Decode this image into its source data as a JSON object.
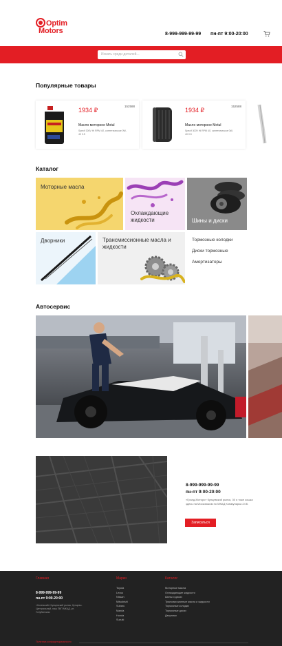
{
  "header": {
    "logo_line1": "Optim",
    "logo_line2": "Motors",
    "phone": "8-999-999-99-99",
    "hours": "пн-пт 9:00-20:00"
  },
  "search": {
    "placeholder": "Искать среди деталей..."
  },
  "popular": {
    "title": "Популярные товары",
    "products": [
      {
        "sku": "152588",
        "price": "1934 ₽",
        "name": "Масло моторное Motul",
        "desc": "Specif 300V Hi RPM 4Л, синтетическое 0W-40 0.5"
      },
      {
        "sku": "152588",
        "price": "1934 ₽",
        "name": "Масло моторное Motul",
        "desc": "Specif 300V Hi RPM 4Л, синтетическое 0W-40 0.5"
      }
    ]
  },
  "catalog": {
    "title": "Каталог",
    "tiles": [
      {
        "label": "Моторные масла"
      },
      {
        "label": "Охлаждающие жидкости"
      },
      {
        "label": "Шины и диски"
      },
      {
        "label": "Дворники"
      },
      {
        "label": "Трансмиссионные масла и жидкости"
      }
    ],
    "links": [
      "Тормозные колодки",
      "Диски тормозные",
      "Амортизаторы"
    ]
  },
  "service": {
    "title": "Автосервис"
  },
  "contacts": {
    "phone": "8-999-999-99-99",
    "hours": "пн-пт 9:00-20:00",
    "address": "«Гранд-Моторс» Кунцевский рынок, 30 я тоже кошка здесь на Московском по МКАД Коммунарка 24 Б",
    "button": "Записаться"
  },
  "footer": {
    "col1": {
      "title": "Главная",
      "phone": "8-999-999-99-99",
      "hours": "пн-пт 9:00-20:00",
      "address": "«Кочевский» Кунцевский рынок, Кунцево-Центральный, наш ПКП МКАД, ул. Голубинская"
    },
    "col2": {
      "title": "Марки",
      "items": [
        "Toyota",
        "Lexus",
        "Nissan",
        "Mitsubishi",
        "Subaru",
        "Mazda",
        "Honda",
        "Suzuki"
      ]
    },
    "col3": {
      "title": "Каталог",
      "items": [
        "Моторные масла",
        "Охлаждающие жидкости",
        "Шины и диски",
        "Трансмиссионные масла и жидкости",
        "Тормозные колодки",
        "Тормозные диски",
        "Дворники"
      ]
    },
    "bottom": "Политика конфиденциальности"
  },
  "colors": {
    "accent": "#e31e24",
    "footer_bg": "#222222"
  }
}
